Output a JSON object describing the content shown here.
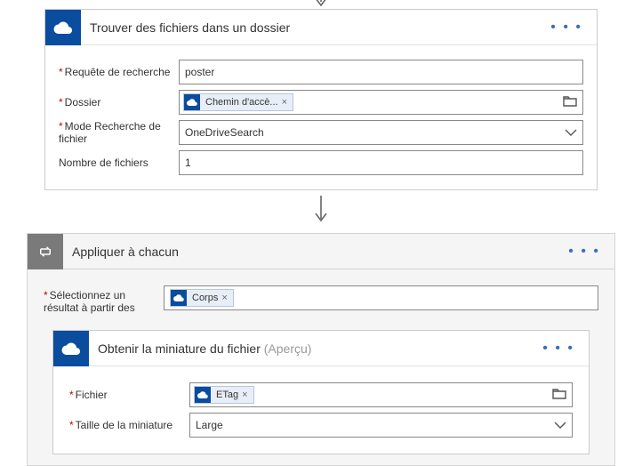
{
  "action1": {
    "title": "Trouver des fichiers dans un dossier",
    "labels": {
      "query": "Requête de recherche",
      "folder": "Dossier",
      "mode": "Mode Recherche de fichier",
      "count": "Nombre de fichiers"
    },
    "values": {
      "query": "poster",
      "folder_token": "Chemin d'accè...",
      "mode": "OneDriveSearch",
      "count": "1"
    }
  },
  "apply": {
    "title": "Appliquer à chacun",
    "labels": {
      "select": "Sélectionnez un résultat à partir des"
    },
    "values": {
      "select_token": "Corps"
    }
  },
  "action2": {
    "title": "Obtenir la miniature du fichier ",
    "preview": "(Aperçu)",
    "labels": {
      "file": "Fichier",
      "size": "Taille de la miniature"
    },
    "values": {
      "file_token": "ETag",
      "size": "Large"
    }
  },
  "glyphs": {
    "close": "×",
    "dots": "• • •"
  }
}
